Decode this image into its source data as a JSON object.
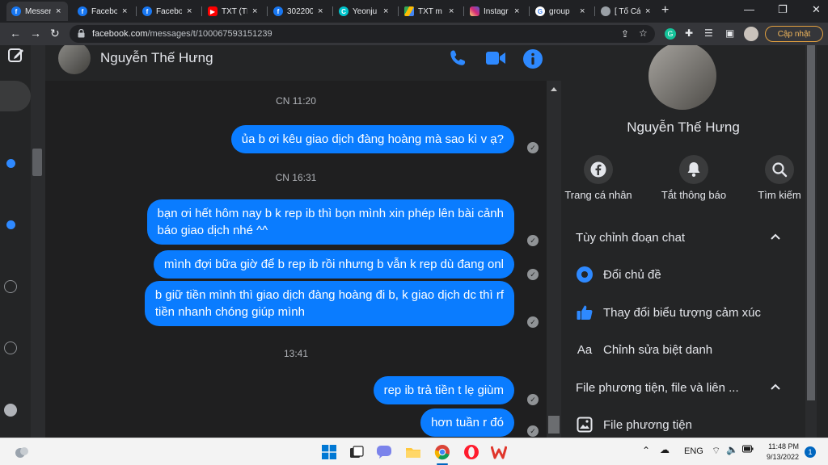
{
  "browser": {
    "tabs": [
      {
        "title": "Messer",
        "favicon": "messenger-icon",
        "color": "#1877f2",
        "active": true
      },
      {
        "title": "Facebo",
        "favicon": "facebook-icon",
        "color": "#1877f2"
      },
      {
        "title": "Facebo",
        "favicon": "facebook-icon",
        "color": "#1877f2"
      },
      {
        "title": "TXT (TI",
        "favicon": "youtube-icon",
        "color": "#ff0000"
      },
      {
        "title": "302200",
        "favicon": "facebook-icon",
        "color": "#1877f2"
      },
      {
        "title": "Yeonju",
        "favicon": "canva-icon",
        "color": "#00c4cc"
      },
      {
        "title": "TXT m",
        "favicon": "drive-icon",
        "color": "#fbbc04"
      },
      {
        "title": "Instagr",
        "favicon": "instagram-icon",
        "color": "#e1306c"
      },
      {
        "title": "group",
        "favicon": "google-icon",
        "color": "#ffffff"
      },
      {
        "title": "[ Tố Cá",
        "favicon": "globe-icon",
        "color": "#9aa0a6"
      }
    ],
    "url_host": "facebook.com",
    "url_path": "/messages/t/100067593151239",
    "update_label": "Cập nhật"
  },
  "chat": {
    "contact_name": "Nguyễn Thế Hưng",
    "messages": [
      {
        "type": "time",
        "text": "CN 11:20"
      },
      {
        "type": "msg",
        "text": "ủa b ơi kêu giao dịch đàng hoàng mà sao kì v ạ?"
      },
      {
        "type": "time",
        "text": "CN 16:31"
      },
      {
        "type": "msg",
        "lines": [
          "bạn ơi hết hôm nay b k rep ib thì bọn mình xin phép lên bài cảnh",
          "báo giao dịch nhé ^^"
        ]
      },
      {
        "type": "msg",
        "text": "mình đợi bữa giờ để b rep ib rồi nhưng b vẫn k rep dù đang onl"
      },
      {
        "type": "msg",
        "lines": [
          "b giữ tiền mình thì giao dịch đàng hoàng đi b, k giao dịch dc thì rf",
          "tiền nhanh chóng giúp mình"
        ]
      },
      {
        "type": "time",
        "text": "13:41"
      },
      {
        "type": "msg",
        "text": "rep ib trả tiền t lẹ giùm"
      },
      {
        "type": "msg",
        "text": "hơn tuần r đó"
      }
    ]
  },
  "info": {
    "name": "Nguyễn Thế Hưng",
    "actions": [
      {
        "label": "Trang cá nhân",
        "icon": "facebook-icon"
      },
      {
        "label": "Tắt thông báo",
        "icon": "bell-icon"
      },
      {
        "label": "Tìm kiếm",
        "icon": "search-icon"
      }
    ],
    "section1_title": "Tùy chỉnh đoạn chat",
    "options": [
      {
        "label": "Đổi chủ đề",
        "icon": "theme-icon"
      },
      {
        "label": "Thay đổi biểu tượng cảm xúc",
        "icon": "thumbs-up-icon"
      },
      {
        "label": "Chỉnh sửa biệt danh",
        "icon": "nickname-icon",
        "glyph": "Aa"
      }
    ],
    "section2_title": "File phương tiện, file và liên ...",
    "media_option": "File phương tiện"
  },
  "taskbar": {
    "lang": "ENG",
    "time": "11:48 PM",
    "date": "9/13/2022",
    "notifications": "1"
  },
  "colors": {
    "accent": "#0a7cff",
    "background": "#242526"
  }
}
